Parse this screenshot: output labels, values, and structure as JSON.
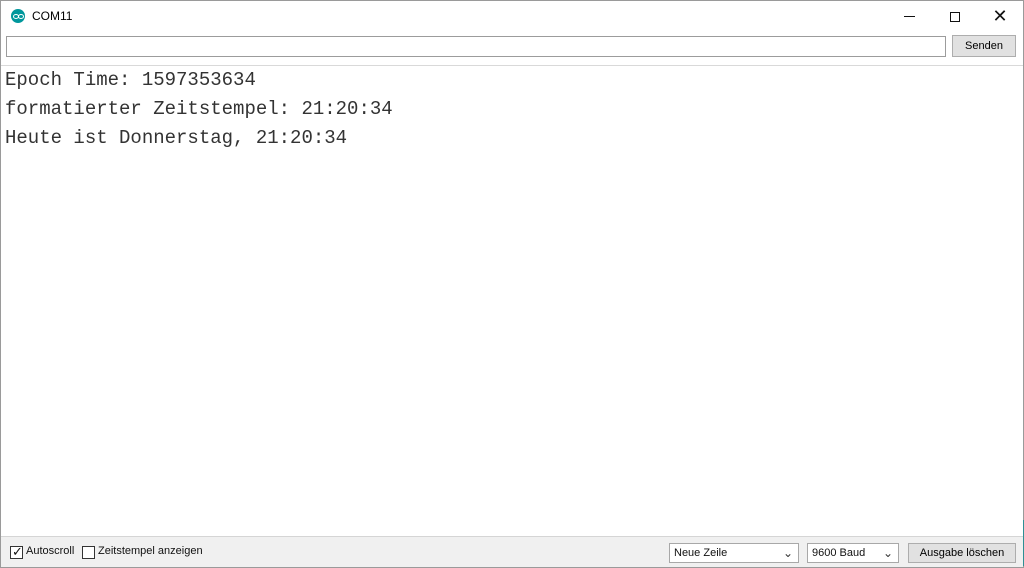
{
  "window": {
    "title": "COM11",
    "icon": "arduino-infinity-icon",
    "controls": {
      "minimize_icon": "minimize-icon",
      "maximize_icon": "maximize-icon",
      "close_icon": "close-icon",
      "close_glyph": "✕"
    }
  },
  "send_bar": {
    "input_value": "",
    "input_placeholder": "",
    "send_label": "Senden"
  },
  "serial_monitor": {
    "lines": [
      "Epoch Time: 1597353634",
      "formatierter Zeitstempel: 21:20:34",
      "Heute ist Donnerstag, 21:20:34"
    ]
  },
  "statusbar": {
    "autoscroll_label": "Autoscroll",
    "autoscroll_checked": true,
    "autoscroll_check_glyph": "✓",
    "timestamp_label": "Zeitstempel anzeigen",
    "timestamp_checked": false,
    "line_ending": "Neue Zeile",
    "baud_rate": "9600 Baud",
    "dropdown_glyph": "⌄",
    "clear_output_label": "Ausgabe löschen"
  },
  "colors": {
    "accent": "#00979c",
    "button_background": "#e1e1e1",
    "statusbar_background": "#f0f0f0"
  }
}
